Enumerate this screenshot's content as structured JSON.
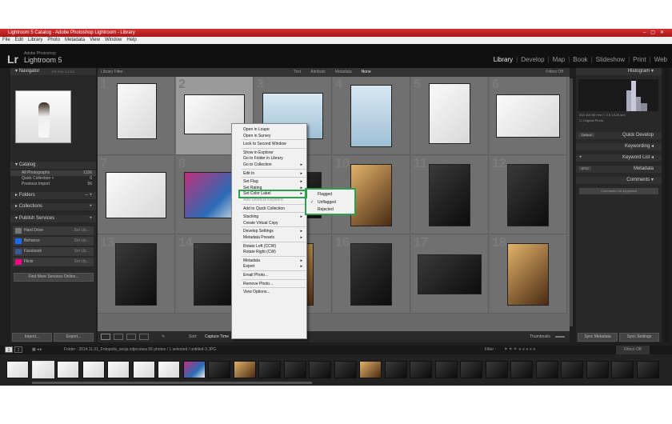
{
  "window": {
    "title": "Lightroom 5 Catalog - Adobe Photoshop Lightroom - Library"
  },
  "menu": [
    "File",
    "Edit",
    "Library",
    "Photo",
    "Metadata",
    "View",
    "Window",
    "Help"
  ],
  "identity": {
    "logo": "Lr",
    "brand_small": "Adobe Photoshop",
    "brand": "Lightroom 5"
  },
  "modules": [
    "Library",
    "Develop",
    "Map",
    "Book",
    "Slideshow",
    "Print",
    "Web"
  ],
  "left_panel": {
    "navigator": "Navigator",
    "nav_zoom": "FIT  FILL  1:1  3:1",
    "catalog": "Catalog",
    "catalog_items": [
      {
        "label": "All Photographs",
        "count": "1156"
      },
      {
        "label": "Quick Collection +",
        "count": "0"
      },
      {
        "label": "Previous Import",
        "count": "56"
      }
    ],
    "folders": "Folders",
    "collections": "Collections",
    "publish": "Publish Services",
    "services": [
      {
        "label": "Hard Drive",
        "action": "Set Up..."
      },
      {
        "label": "Behance",
        "action": "Set Up..."
      },
      {
        "label": "Facebook",
        "action": "Set Up..."
      },
      {
        "label": "Flickr",
        "action": "Set Up..."
      }
    ],
    "find_more": "Find More Services Online...",
    "import": "Import...",
    "export": "Export..."
  },
  "filter": {
    "label": "Library Filter :",
    "options": [
      "Text",
      "Attribute",
      "Metadata",
      "None"
    ],
    "right": "Filters Off"
  },
  "right_panel": {
    "histogram": "Histogram",
    "hist_info": "ISO 400    50 mm    f / 2.8    1/125 sec",
    "original_photo": "Original Photo",
    "saved_preset": "Default",
    "quick_develop": "Quick Develop",
    "keywording": "Keywording",
    "keyword_list": "Keyword List",
    "metadata_preset": "IPTC",
    "metadata": "Metadata",
    "comments": "Comments",
    "comments_note": "Comments not supported",
    "sync_metadata": "Sync Metadata",
    "sync_settings": "Sync Settings"
  },
  "toolbar": {
    "sort_label": "Sort:",
    "sort_value": "Capture Time",
    "thumbnails": "Thumbnails"
  },
  "filmstrip": {
    "pages": [
      "1",
      "2"
    ],
    "path": "Folder : 2014.11.01_Fotopolis_sesja zdjeciowa    56 photos / 1 selected / untitled-3.JPG",
    "filter_label": "Filter :",
    "filter_value": "Filters Off"
  },
  "grid_numbers": [
    "1",
    "2",
    "3",
    "4",
    "5",
    "6",
    "7",
    "8",
    "9",
    "10",
    "11",
    "12",
    "13",
    "14",
    "15",
    "16",
    "17",
    "18"
  ],
  "context_menu": {
    "items": [
      {
        "label": "Open in Loupe",
        "sub": false,
        "disabled": false
      },
      {
        "label": "Open in Survey",
        "sub": false,
        "disabled": false
      },
      {
        "sep": true
      },
      {
        "label": "Lock to Second Window",
        "sub": false,
        "disabled": false
      },
      {
        "sep": true
      },
      {
        "label": "Show in Explorer",
        "sub": false,
        "disabled": false
      },
      {
        "label": "Go to Folder in Library",
        "sub": false,
        "disabled": false
      },
      {
        "label": "Go to Collection",
        "sub": true,
        "disabled": false
      },
      {
        "sep": true
      },
      {
        "label": "Edit In",
        "sub": true,
        "disabled": false
      },
      {
        "sep": true
      },
      {
        "label": "Set Flag",
        "sub": true,
        "disabled": false
      },
      {
        "label": "Set Rating",
        "sub": true,
        "disabled": false
      },
      {
        "label": "Set Color Label",
        "sub": true,
        "disabled": false
      },
      {
        "label": "Add Shortcut Keyword",
        "sub": false,
        "disabled": true
      },
      {
        "sep": true
      },
      {
        "label": "Add to Quick Collection",
        "sub": false,
        "disabled": false
      },
      {
        "sep": true
      },
      {
        "label": "Stacking",
        "sub": true,
        "disabled": false
      },
      {
        "label": "Create Virtual Copy",
        "sub": false,
        "disabled": false
      },
      {
        "sep": true
      },
      {
        "label": "Develop Settings",
        "sub": true,
        "disabled": false
      },
      {
        "label": "Metadata Presets",
        "sub": true,
        "disabled": false
      },
      {
        "sep": true
      },
      {
        "label": "Rotate Left (CCW)",
        "sub": false,
        "disabled": false
      },
      {
        "label": "Rotate Right (CW)",
        "sub": false,
        "disabled": false
      },
      {
        "sep": true
      },
      {
        "label": "Metadata",
        "sub": true,
        "disabled": false
      },
      {
        "label": "Export",
        "sub": true,
        "disabled": false
      },
      {
        "sep": true
      },
      {
        "label": "Email Photo...",
        "sub": false,
        "disabled": false
      },
      {
        "sep": true
      },
      {
        "label": "Remove Photo...",
        "sub": false,
        "disabled": false
      },
      {
        "sep": true
      },
      {
        "label": "View Options...",
        "sub": false,
        "disabled": false
      }
    ],
    "submenu": [
      {
        "label": "Flagged",
        "checked": false
      },
      {
        "label": "Unflagged",
        "checked": true
      },
      {
        "label": "Rejected",
        "checked": false
      }
    ]
  },
  "colors": {
    "highlight": "#2e9f4e",
    "titlebar": "#c42626"
  }
}
